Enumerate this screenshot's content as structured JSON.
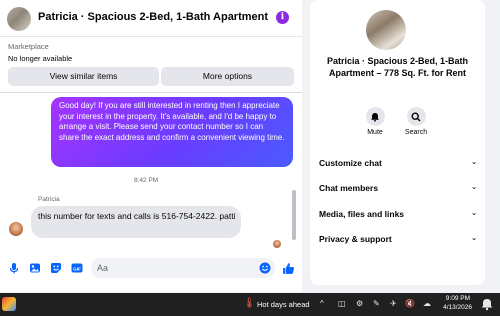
{
  "header": {
    "title": "Patricia · Spacious 2-Bed, 1-Bath Apartment – 778...",
    "info_icon": "info-icon"
  },
  "listing": {
    "marketplace_label": "Marketplace",
    "availability": "No longer available",
    "similar_button": "View similar items",
    "more_button": "More options"
  },
  "messages": {
    "sent_text": "Good day! If you are still interested in renting then I appreciate your interest in the property. It's available, and I'd be happy to arrange a visit. Please send your contact number so I can share the exact address and confirm a convenient viewing time.",
    "timestamp": "8:42 PM",
    "sender_name": "Patricia",
    "received_text": "this number for texts and calls is 516-754-2422. patti"
  },
  "composer": {
    "placeholder": "Aa",
    "icons": [
      "microphone-icon",
      "gallery-icon",
      "sticker-icon",
      "gif-icon",
      "emoji-icon",
      "thumbs-up-icon"
    ]
  },
  "sidebar": {
    "profile_name": "Patricia · Spacious 2-Bed, 1-Bath Apartment – 778 Sq. Ft. for Rent",
    "actions": [
      {
        "label": "Mute",
        "icon": "bell-icon"
      },
      {
        "label": "Search",
        "icon": "search-icon"
      }
    ],
    "menu": [
      {
        "label": "Customize chat"
      },
      {
        "label": "Chat members"
      },
      {
        "label": "Media, files and links"
      },
      {
        "label": "Privacy & support"
      }
    ]
  },
  "taskbar": {
    "weather": "Hot days ahead",
    "time": "9:09 PM",
    "date": "4/13/2026"
  },
  "colors": {
    "accent": "#0866ff",
    "bubble_gradient_start": "#a533ff",
    "bubble_gradient_end": "#4a5bff"
  }
}
